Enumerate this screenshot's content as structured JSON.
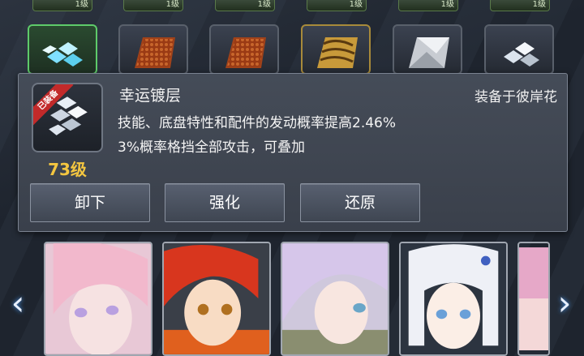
{
  "top_chips": [
    "1级",
    "1级",
    "1级",
    "1级",
    "1级",
    "1级"
  ],
  "items": [
    {
      "name": "crystal-chip-icon",
      "equipped": true
    },
    {
      "name": "copper-plate-icon"
    },
    {
      "name": "copper-plate-icon"
    },
    {
      "name": "gold-plate-icon"
    },
    {
      "name": "steel-plate-icon"
    },
    {
      "name": "crystal-chip-icon"
    }
  ],
  "panel": {
    "equipped_tag": "已装备",
    "level": "73级",
    "item_name": "幸运镀层",
    "equipped_on": "装备于彼岸花",
    "desc_line1": "技能、底盘特性和配件的发动概率提高2.46%",
    "desc_line2": "3%概率格挡全部攻击，可叠加",
    "buttons": {
      "unequip": "卸下",
      "enhance": "强化",
      "restore": "还原"
    }
  },
  "characters": [
    "pink-haired-girl",
    "red-haired-girl",
    "lavender-haired-girl",
    "silver-haired-girl",
    "partial-portrait"
  ],
  "colors": {
    "level": "#f4c640",
    "equipped_tag": "#c22a2a",
    "accent_green": "#5ecb6a"
  }
}
